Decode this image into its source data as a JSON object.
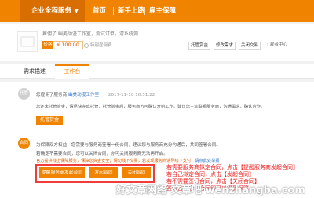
{
  "nav": {
    "active_label": "企业全程服务",
    "items": [
      "首页",
      "新手上路",
      "雇主保障"
    ]
  },
  "order": {
    "meta_line": "雇佣了 幽美动漫工作室，测试订单，请系统测",
    "price_label": "价格",
    "price_value": "¥ 100.00",
    "bonus_label": "特别雇佣费",
    "actions": [
      "托管赏金",
      "修改需求",
      "关闭交易"
    ],
    "collect_label": "雇者中心"
  },
  "tabs": [
    "需求描述",
    "工作台"
  ],
  "steps": [
    {
      "label": "托管"
    },
    {
      "label": "合同"
    }
  ],
  "step1": {
    "line1_prefix": "您雇佣了服务商",
    "line1_link": "幽美动漫工作室",
    "line1_time": "2017-11-10  10:51:22",
    "line2": "您还未托管赏金，请尽快完成托管，托管赏金后，服务商方可确认开始工作。建议您主动联系服务商，沟通需求，确认合作。",
    "button": "托管赏金"
  },
  "step2": {
    "line1": "为保障双方权益，您需要与服务商签署一份合同，建议您与服务商充分沟通后，共同签署合同。",
    "line2": "若确定不需要合同，您可以关闭合同，亦可关闭服务商无法再开启。",
    "line3_prefix": "官方提供线上保障服务，保障您资金安全，请勿线下交易，若发现服务商诱导线下支付，",
    "line3_link": "请点此处举报",
    "buttons": [
      "提醒服务商发起合同",
      "发起合同",
      "关闭合同"
    ]
  },
  "annotations": [
    "若需要服务商拟定合同，点击【提醒服务商发起合同】",
    "若自己拟定合同，点击【发起合同】",
    "若不需要签订合同，点击【关闭合同】",
    "签订合同后，合同即可以得到保障"
  ],
  "watermark": "好文章网络·文章吧 wenzhangba.com",
  "colors": {
    "brand_orange": "#f08300",
    "annotation_red": "#ee2222",
    "link_blue": "#2d6fc4"
  }
}
